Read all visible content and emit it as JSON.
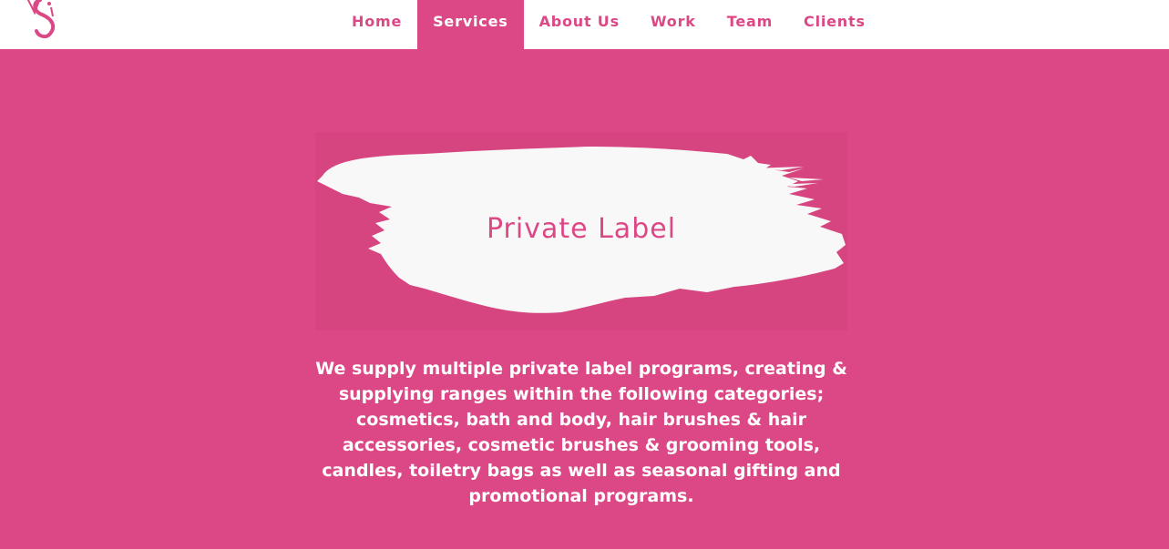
{
  "colors": {
    "brand_pink": "#db4885",
    "panel_pink": "#d6457f",
    "header_bg": "#ffffff",
    "brush_white": "#f8f8f8"
  },
  "header": {
    "logo_icon": "vs-monogram-icon",
    "nav": {
      "items": [
        {
          "label": "Home",
          "active": false
        },
        {
          "label": "Services",
          "active": true
        },
        {
          "label": "About Us",
          "active": false
        },
        {
          "label": "Work",
          "active": false
        },
        {
          "label": "Team",
          "active": false
        },
        {
          "label": "Clients",
          "active": false
        }
      ]
    }
  },
  "main": {
    "section_title": "Private Label",
    "description": "We supply multiple private label programs, creating & supplying ranges within the following categories; cosmetics, bath and body, hair brushes & hair accessories, cosmetic brushes & grooming tools, candles, toiletry bags as well as seasonal gifting and promotional programs."
  }
}
